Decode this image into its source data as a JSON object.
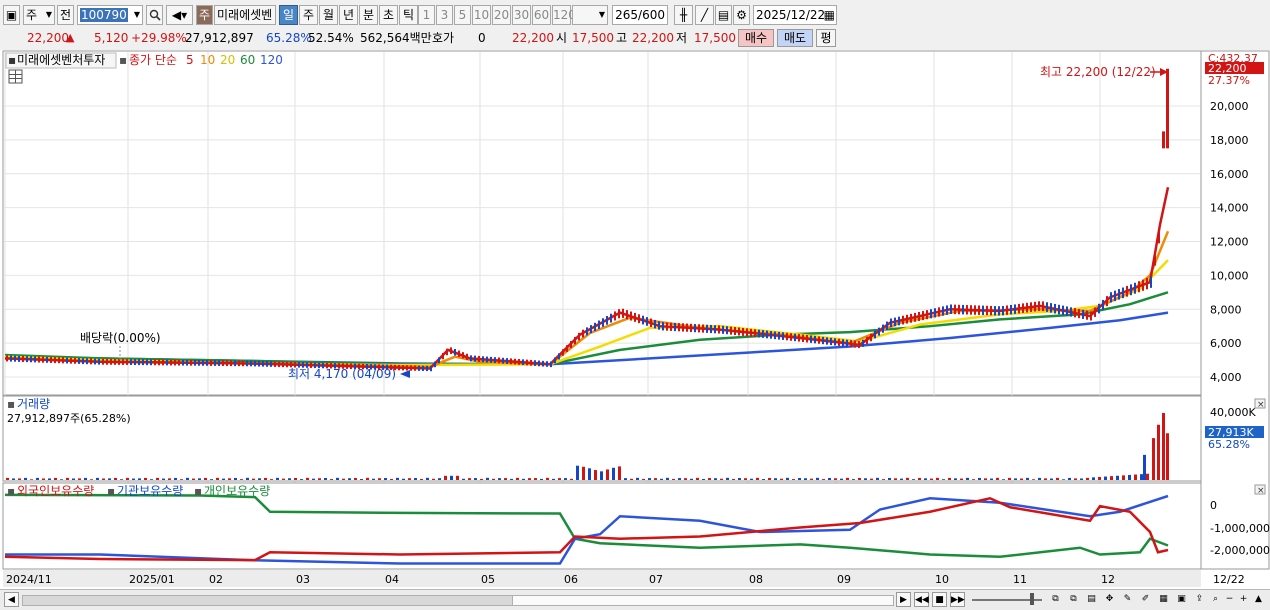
{
  "toolbar": {
    "market": "주",
    "market_alt": "전",
    "code": "100790",
    "name": "미래에셋벤",
    "periods": [
      "일",
      "주",
      "월",
      "년",
      "분",
      "초",
      "틱"
    ],
    "minutes": [
      "1",
      "3",
      "5",
      "10",
      "20",
      "30",
      "60",
      "120"
    ],
    "bars": "265",
    "bars_total": "/600",
    "date": "2025/12/22",
    "name_badge": "주"
  },
  "quote": {
    "price": "22,200",
    "change": "5,120",
    "change_pct": "+29.98%",
    "volume": "27,912,897",
    "turnover_pct": "65.28%",
    "other_pct": "52.54%",
    "amount": "562,564백만",
    "ask_label": "호가",
    "ask_value": "0",
    "ask_price": "22,200",
    "open_label": "시",
    "open": "17,500",
    "high_label": "고",
    "high": "22,200",
    "low_label": "저",
    "low": "17,500",
    "buy": "매수",
    "sell": "매도",
    "avg": "평"
  },
  "legend": {
    "name": "미래에셋벤처투자",
    "ma_label": "종가 단순",
    "ma_periods": [
      "5",
      "10",
      "20",
      "60",
      "120"
    ],
    "ma_colors": [
      "#d21414",
      "#f08a00",
      "#f3dd00",
      "#1b8c3a",
      "#2d55dc"
    ]
  },
  "price_panel": {
    "labels": [
      "20,000",
      "18,000",
      "16,000",
      "14,000",
      "12,000",
      "10,000",
      "8,000",
      "6,000",
      "4,000"
    ],
    "current_tag": "22,200",
    "pct_tag": "27.37%",
    "corner": "C:432.37",
    "high_note": "최고 22,200 (12/22)",
    "low_note": "최저 4,170 (04/09)",
    "div_note": "배당락(0.00%)"
  },
  "volume_panel": {
    "title": "거래량",
    "summary": "27,912,897주(65.28%)",
    "top_label": "40,000K",
    "cur_tag": "27,913K",
    "cur_pct": "65.28%"
  },
  "holdings_panel": {
    "series": [
      {
        "name": "외국인보유수량",
        "color": "#d21414"
      },
      {
        "name": "기관보유수량",
        "color": "#2d55dc"
      },
      {
        "name": "개인보유수량",
        "color": "#1b8c3a"
      }
    ],
    "labels": [
      "0",
      "-1,000,000",
      "-2,000,000"
    ]
  },
  "x_axis": {
    "labels": [
      "2024/11",
      "2025/01",
      "02",
      "03",
      "04",
      "05",
      "06",
      "07",
      "08",
      "09",
      "10",
      "11",
      "12"
    ],
    "end_label": "12/22"
  }
}
